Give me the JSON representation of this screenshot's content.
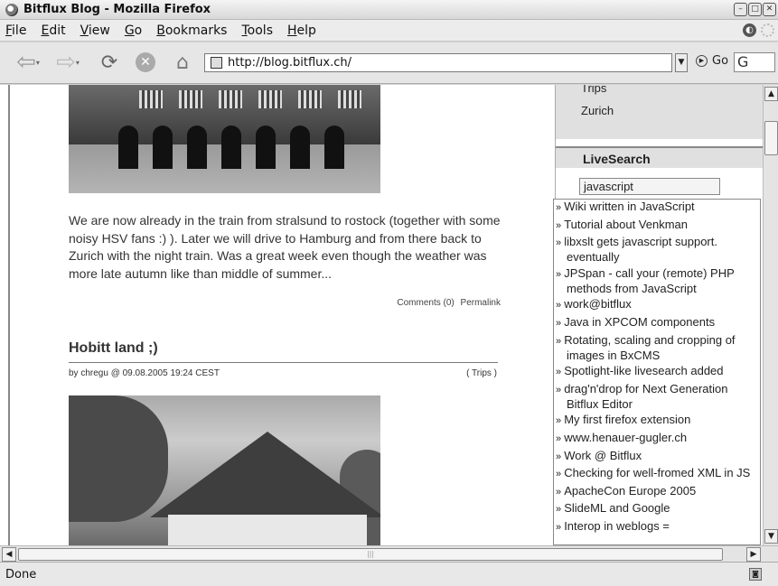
{
  "window": {
    "title": "Bitflux Blog - Mozilla Firefox"
  },
  "menu": [
    "File",
    "Edit",
    "View",
    "Go",
    "Bookmarks",
    "Tools",
    "Help"
  ],
  "toolbar": {
    "url": "http://blog.bitflux.ch/",
    "go_label": "Go",
    "search_value": "G"
  },
  "post1": {
    "text": "We are now already in the train from stralsund to rostock (together with some noisy HSV fans :) ). Later we will drive to Hamburg and from there back to Zurich with the night train. Was a great week even though the weather was more late autumn like than middle of summer...",
    "comments": "Comments (0)",
    "permalink": "Permalink"
  },
  "post2": {
    "title": "Hobitt land ;)",
    "byline": "by chregu @ 09.08.2005 19:24 CEST",
    "category": "( Trips )"
  },
  "sidebar": {
    "link_trips": "Trips",
    "link_zurich": "Zurich",
    "livesearch_title": "LiveSearch",
    "livesearch_value": "javascript",
    "results": [
      "Wiki written in JavaScript",
      "Tutorial about Venkman",
      "libxslt gets javascript support. eventually",
      "JPSpan - call your (remote) PHP methods from JavaScript",
      "work@bitflux",
      "Java in XPCOM components",
      "Rotating, scaling and cropping of images in BxCMS",
      "Spotlight-like livesearch added",
      "drag'n'drop for Next Generation Bitflux Editor",
      "My first firefox extension",
      "www.henauer-gugler.ch",
      "Work @ Bitflux",
      "Checking for well-fromed XML in JS",
      "ApacheCon Europe 2005",
      "SlideML and Google",
      "Interop in weblogs ="
    ]
  },
  "status": {
    "text": "Done"
  }
}
